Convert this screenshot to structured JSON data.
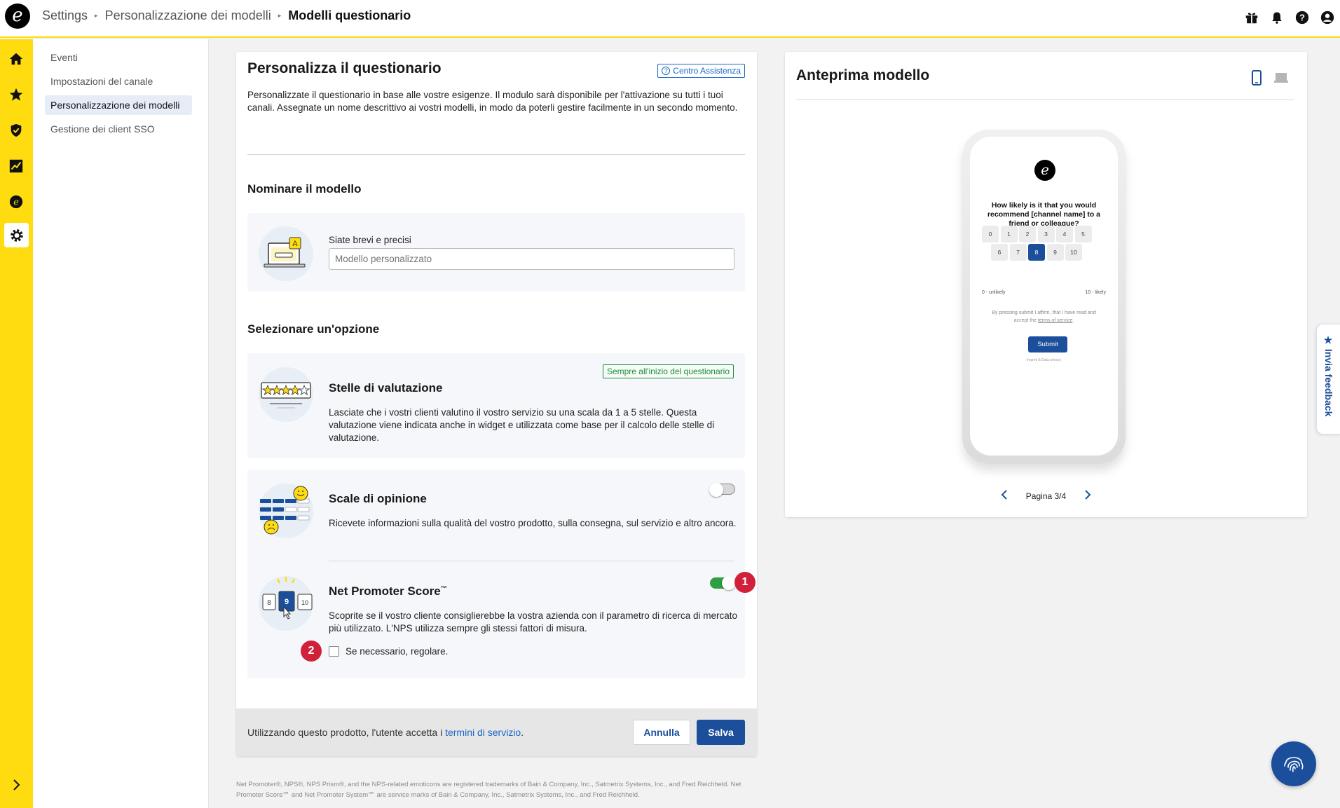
{
  "header": {
    "logo_text": "e",
    "breadcrumb": [
      "Settings",
      "Personalizzazione dei modelli",
      "Modelli questionario"
    ],
    "icons": [
      "gift-icon",
      "bell-icon",
      "help-icon",
      "user-icon"
    ]
  },
  "rail": {
    "icons": [
      "home-icon",
      "star-icon",
      "shield-icon",
      "chart-icon",
      "trusted-e-icon",
      "gear-icon"
    ],
    "active": "gear-icon",
    "expand_icon": "chevron-right-icon"
  },
  "subnav": {
    "items": [
      {
        "label": "Eventi"
      },
      {
        "label": "Impostazioni del canale"
      },
      {
        "label": "Personalizzazione dei modelli",
        "active": true
      },
      {
        "label": "Gestione dei client SSO"
      }
    ]
  },
  "main": {
    "title": "Personalizza il questionario",
    "help_label": "Centro Assistenza",
    "intro": "Personalizzate il questionario in base alle vostre esigenze. Il modulo sarà disponibile per l'attivazione su tutti i tuoi canali. Assegnate un nome descrittivo ai vostri modelli, in modo da poterli gestire facilmente in un secondo momento.",
    "name_section": {
      "heading": "Nominare il modello",
      "label": "Siate brevi e precisi",
      "placeholder": "Modello personalizzato"
    },
    "options_heading": "Selezionare un'opzione",
    "stars": {
      "title": "Stelle di valutazione",
      "tag": "Sempre all'inizio del questionario",
      "description": "Lasciate che i vostri clienti valutino il vostro servizio su una scala da 1 a 5 stelle. Questa valutazione viene indicata anche in widget e utilizzata come base per il calcolo delle stelle di valutazione."
    },
    "opinion": {
      "title": "Scale di opinione",
      "description": "Ricevete informazioni sulla qualità del vostro prodotto, sulla consegna, sul servizio e altro ancora.",
      "enabled": false
    },
    "nps": {
      "title": "Net Promoter Score",
      "tm": "™",
      "description": "Scoprite se il vostro cliente consiglierebbe la vostra azienda con il parametro di ricerca di mercato più utilizzato. L'NPS utilizza sempre gli stessi fattori di misura.",
      "enabled": true,
      "checkbox_label": "Se necessario, regolare.",
      "checkbox_checked": false,
      "illus_numbers": [
        "8",
        "9",
        "10"
      ]
    },
    "badges": [
      "1",
      "2"
    ],
    "footer": {
      "text": "Utilizzando questo prodotto, l'utente accetta i ",
      "link": "termini di servizio",
      "period": ".",
      "cancel": "Annulla",
      "save": "Salva"
    }
  },
  "legal": "Net Promoter®, NPS®, NPS Prism®, and the NPS-related emoticons are registered trademarks of Bain & Company, Inc., Satmetrix Systems, Inc., and Fred Reichheld. Net Promoter Score℠ and Net Promoter System℠ are service marks of Bain & Company, Inc., Satmetrix Systems, Inc., and Fred Reichheld.",
  "preview": {
    "title": "Anteprima modello",
    "devices": [
      "mobile-icon",
      "laptop-icon"
    ],
    "question": "How likely is it that you would recommend [channel name] to a friend or colleague?",
    "scale_row1": [
      "0",
      "1",
      "2",
      "3",
      "4",
      "5"
    ],
    "scale_row2": [
      "6",
      "7",
      "8",
      "9",
      "10"
    ],
    "selected": "8",
    "low_label": "0 - unlikely",
    "high_label": "10 - likely",
    "consent_text": "By pressing submit I affirm, that I have read and accept the ",
    "consent_link": "terms of service",
    "consent_end": ".",
    "submit": "Submit",
    "imprint": "Imprint & Data privacy",
    "pager": "Pagina 3/4"
  },
  "feedback": {
    "label": "Invia feedback"
  },
  "colors": {
    "accent_yellow": "#ffdc0f",
    "primary_blue": "#1b4f9c",
    "toggle_on": "#2f9e44",
    "badge_red": "#d1213a"
  }
}
